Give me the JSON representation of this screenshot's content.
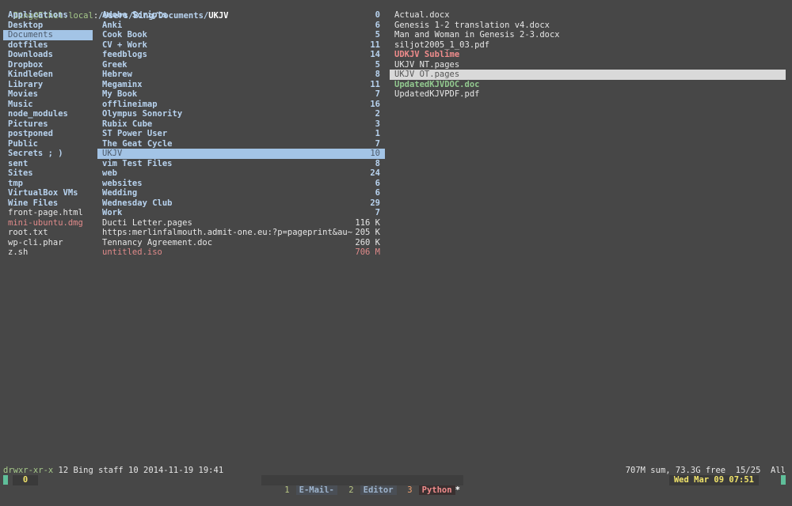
{
  "titlebar": {
    "host": "Bing@Ethel.local",
    "colon": ":",
    "path": "/Users/Bing/Documents/",
    "current": "UKJV"
  },
  "parent_column": [
    {
      "name": "Applications",
      "type": "dir"
    },
    {
      "name": "Desktop",
      "type": "dir"
    },
    {
      "name": "Documents",
      "type": "dir",
      "selected": true
    },
    {
      "name": "dotfiles",
      "type": "dir"
    },
    {
      "name": "Downloads",
      "type": "dir"
    },
    {
      "name": "Dropbox",
      "type": "dir"
    },
    {
      "name": "KindleGen",
      "type": "dir"
    },
    {
      "name": "Library",
      "type": "dir"
    },
    {
      "name": "Movies",
      "type": "dir"
    },
    {
      "name": "Music",
      "type": "dir"
    },
    {
      "name": "node_modules",
      "type": "dir"
    },
    {
      "name": "Pictures",
      "type": "dir"
    },
    {
      "name": "postponed",
      "type": "dir"
    },
    {
      "name": "Public",
      "type": "dir"
    },
    {
      "name": "Secrets ; )",
      "type": "dir"
    },
    {
      "name": "sent",
      "type": "dir"
    },
    {
      "name": "Sites",
      "type": "dir"
    },
    {
      "name": "tmp",
      "type": "dir"
    },
    {
      "name": "VirtualBox VMs",
      "type": "dir"
    },
    {
      "name": "Wine Files",
      "type": "dir"
    },
    {
      "name": "front-page.html",
      "type": "file"
    },
    {
      "name": "mini-ubuntu.dmg",
      "type": "red"
    },
    {
      "name": "root.txt",
      "type": "file"
    },
    {
      "name": "wp-cli.phar",
      "type": "file"
    },
    {
      "name": "z.sh",
      "type": "file"
    }
  ],
  "current_column": [
    {
      "name": "Adobe Scripts",
      "size": "0",
      "type": "dir"
    },
    {
      "name": "Anki",
      "size": "6",
      "type": "dir"
    },
    {
      "name": "Cook Book",
      "size": "5",
      "type": "dir"
    },
    {
      "name": "CV + Work",
      "size": "11",
      "type": "dir"
    },
    {
      "name": "feedblogs",
      "size": "14",
      "type": "dir"
    },
    {
      "name": "Greek",
      "size": "5",
      "type": "dir"
    },
    {
      "name": "Hebrew",
      "size": "8",
      "type": "dir"
    },
    {
      "name": "Megaminx",
      "size": "11",
      "type": "dir"
    },
    {
      "name": "My Book",
      "size": "7",
      "type": "dir"
    },
    {
      "name": "offlineimap",
      "size": "16",
      "type": "dir"
    },
    {
      "name": "Olympus Sonority",
      "size": "2",
      "type": "dir"
    },
    {
      "name": "Rubix Cube",
      "size": "3",
      "type": "dir"
    },
    {
      "name": "ST Power User",
      "size": "1",
      "type": "dir"
    },
    {
      "name": "The Geat Cycle",
      "size": "7",
      "type": "dir"
    },
    {
      "name": "UKJV",
      "size": "10",
      "type": "dir",
      "selected": true
    },
    {
      "name": "vim Test Files",
      "size": "8",
      "type": "dir"
    },
    {
      "name": "web",
      "size": "24",
      "type": "dir"
    },
    {
      "name": "websites",
      "size": "6",
      "type": "dir"
    },
    {
      "name": "Wedding",
      "size": "6",
      "type": "dir"
    },
    {
      "name": "Wednesday Club",
      "size": "29",
      "type": "dir"
    },
    {
      "name": "Work",
      "size": "7",
      "type": "dir"
    },
    {
      "name": "Ducti Letter.pages",
      "size": "116 K",
      "type": "file"
    },
    {
      "name": "https:merlinfalmouth.admit-one.eu:?p=pageprint&au~",
      "size": "205 K",
      "type": "file"
    },
    {
      "name": "Tennancy Agreement.doc",
      "size": "260 K",
      "type": "file"
    },
    {
      "name": "untitled.iso",
      "size": "706 M",
      "type": "red"
    }
  ],
  "preview_column": [
    {
      "name": "Actual.docx",
      "type": "file"
    },
    {
      "name": "Genesis 1-2 translation v4.docx",
      "type": "file"
    },
    {
      "name": "Man and Woman in Genesis 2-3.docx",
      "type": "file"
    },
    {
      "name": "siljot2005_1_03.pdf",
      "type": "file"
    },
    {
      "name": "UDKJV Sublime",
      "type": "redb"
    },
    {
      "name": "UKJV NT.pages",
      "type": "file"
    },
    {
      "name": "UKJV OT.pages",
      "type": "file",
      "selected": true
    },
    {
      "name": "UpdatedKJVDOC.doc",
      "type": "green"
    },
    {
      "name": "UpdatedKJVPDF.pdf",
      "type": "file"
    }
  ],
  "status": {
    "permissions": "drwxr-xr-x",
    "details": " 12 Bing staff 10 2014-11-19 19:41",
    "right": "707M sum, 73.3G free  15/25  All"
  },
  "tmux": {
    "session": "0",
    "windows": [
      {
        "num": "1",
        "label": "E-Mail-",
        "flag": "",
        "active": false
      },
      {
        "num": "2",
        "label": "Editor",
        "flag": "",
        "active": false
      },
      {
        "num": "3",
        "label": "Python",
        "flag": "*",
        "active": true
      }
    ],
    "clock": "Wed Mar 09 07:51"
  }
}
